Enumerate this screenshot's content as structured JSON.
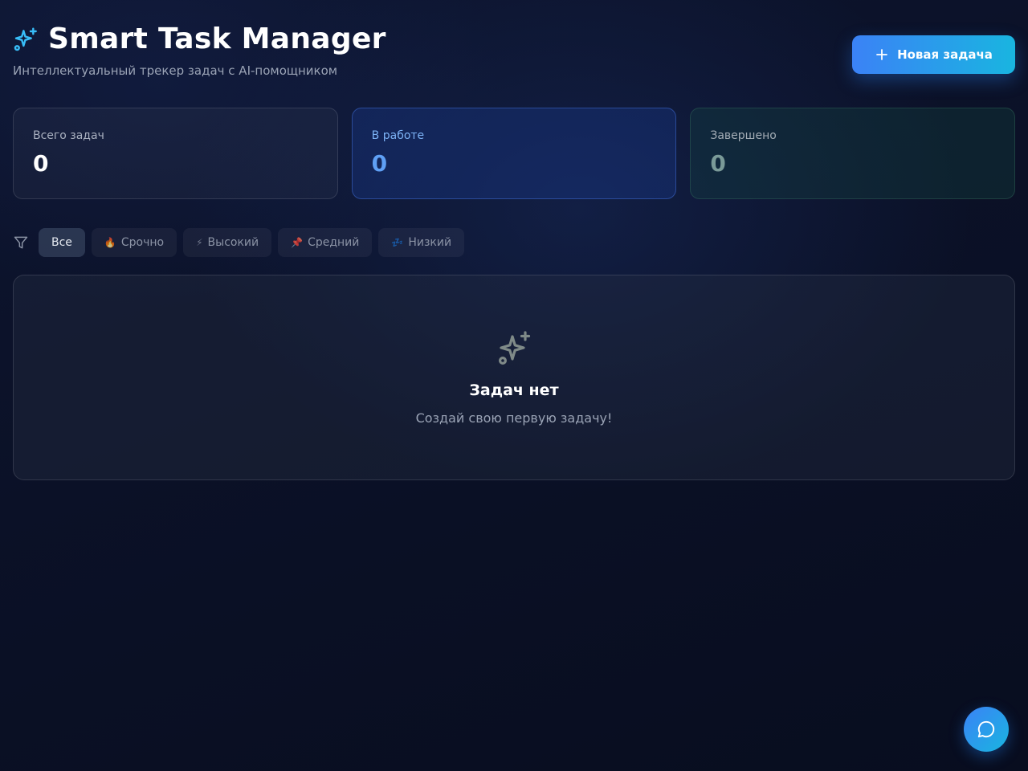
{
  "header": {
    "title": "Smart Task Manager",
    "subtitle": "Интеллектуальный трекер задач с AI-помощником",
    "new_task_label": "Новая задача"
  },
  "stats": [
    {
      "label": "Всего задач",
      "value": "0"
    },
    {
      "label": "В работе",
      "value": "0"
    },
    {
      "label": "Завершено",
      "value": "0"
    }
  ],
  "filters": [
    {
      "label": "Все",
      "emoji": ""
    },
    {
      "label": "Срочно",
      "emoji": "🔥"
    },
    {
      "label": "Высокий",
      "emoji": "⚡"
    },
    {
      "label": "Средний",
      "emoji": "📌"
    },
    {
      "label": "Низкий",
      "emoji": "💤"
    }
  ],
  "empty_state": {
    "title": "Задач нет",
    "text": "Создай свою первую задачу!"
  },
  "colors": {
    "accent_start": "#3b82f6",
    "accent_end": "#19b5e0",
    "background": "#0b1127"
  },
  "icons": {
    "title": "sparkles-icon",
    "new_task": "plus-icon",
    "filter": "filter-icon",
    "empty": "sparkles-icon",
    "chat": "chat-bubble-icon"
  }
}
